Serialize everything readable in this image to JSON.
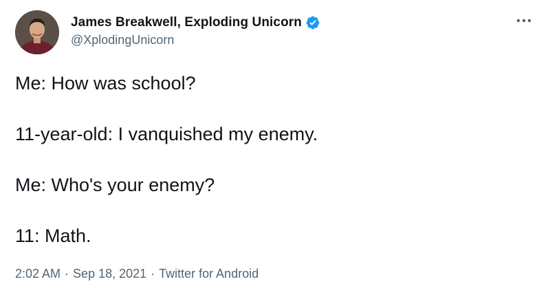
{
  "author": {
    "display_name": "James Breakwell, Exploding Unicorn",
    "handle": "@XplodingUnicorn",
    "verified": true,
    "avatar_icon": "avatar-photo"
  },
  "more_icon": "more-horizontal-icon",
  "tweet": {
    "lines": [
      "Me: How was school?",
      "11-year-old: I vanquished my enemy.",
      "Me: Who's your enemy?",
      "11: Math."
    ]
  },
  "meta": {
    "time": "2:02 AM",
    "separator": "·",
    "date": "Sep 18, 2021",
    "source": "Twitter for Android"
  },
  "colors": {
    "text": "#0f1419",
    "secondary": "#536471",
    "verified": "#1d9bf0"
  }
}
